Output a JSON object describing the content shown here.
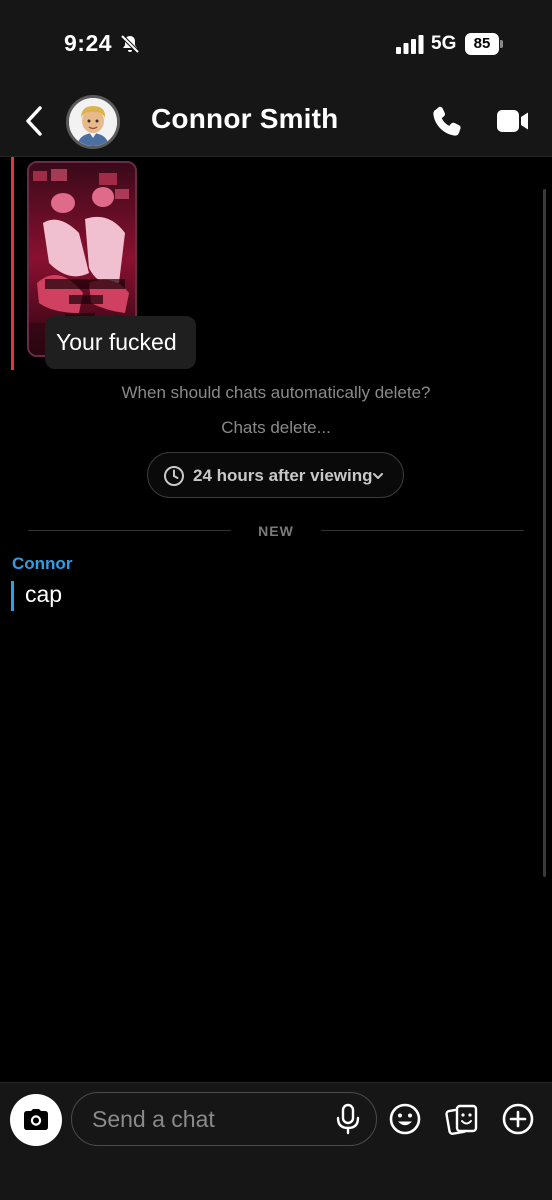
{
  "status_bar": {
    "time": "9:24",
    "network": "5G",
    "battery": "85"
  },
  "header": {
    "contact_name": "Connor Smith"
  },
  "chat": {
    "sent_message": "Your fucked",
    "auto_delete_prompt": "When should chats automatically delete?",
    "chats_delete_label": "Chats delete...",
    "delete_setting": "24 hours after viewing",
    "new_label": "NEW",
    "sender_name": "Connor",
    "received_message": "cap"
  },
  "composer": {
    "placeholder": "Send a chat"
  },
  "icons": [
    "bell-slash-icon",
    "signal-icon",
    "back-chevron-icon",
    "bitmoji-avatar",
    "phone-icon",
    "video-icon",
    "clock-icon",
    "chevron-down-icon",
    "camera-icon",
    "mic-icon",
    "emoji-icon",
    "sticker-icon",
    "plus-icon"
  ],
  "colors": {
    "accent_red": "#e0343f",
    "accent_blue": "#2e9ee6",
    "background": "#000000",
    "bar": "#161616"
  }
}
